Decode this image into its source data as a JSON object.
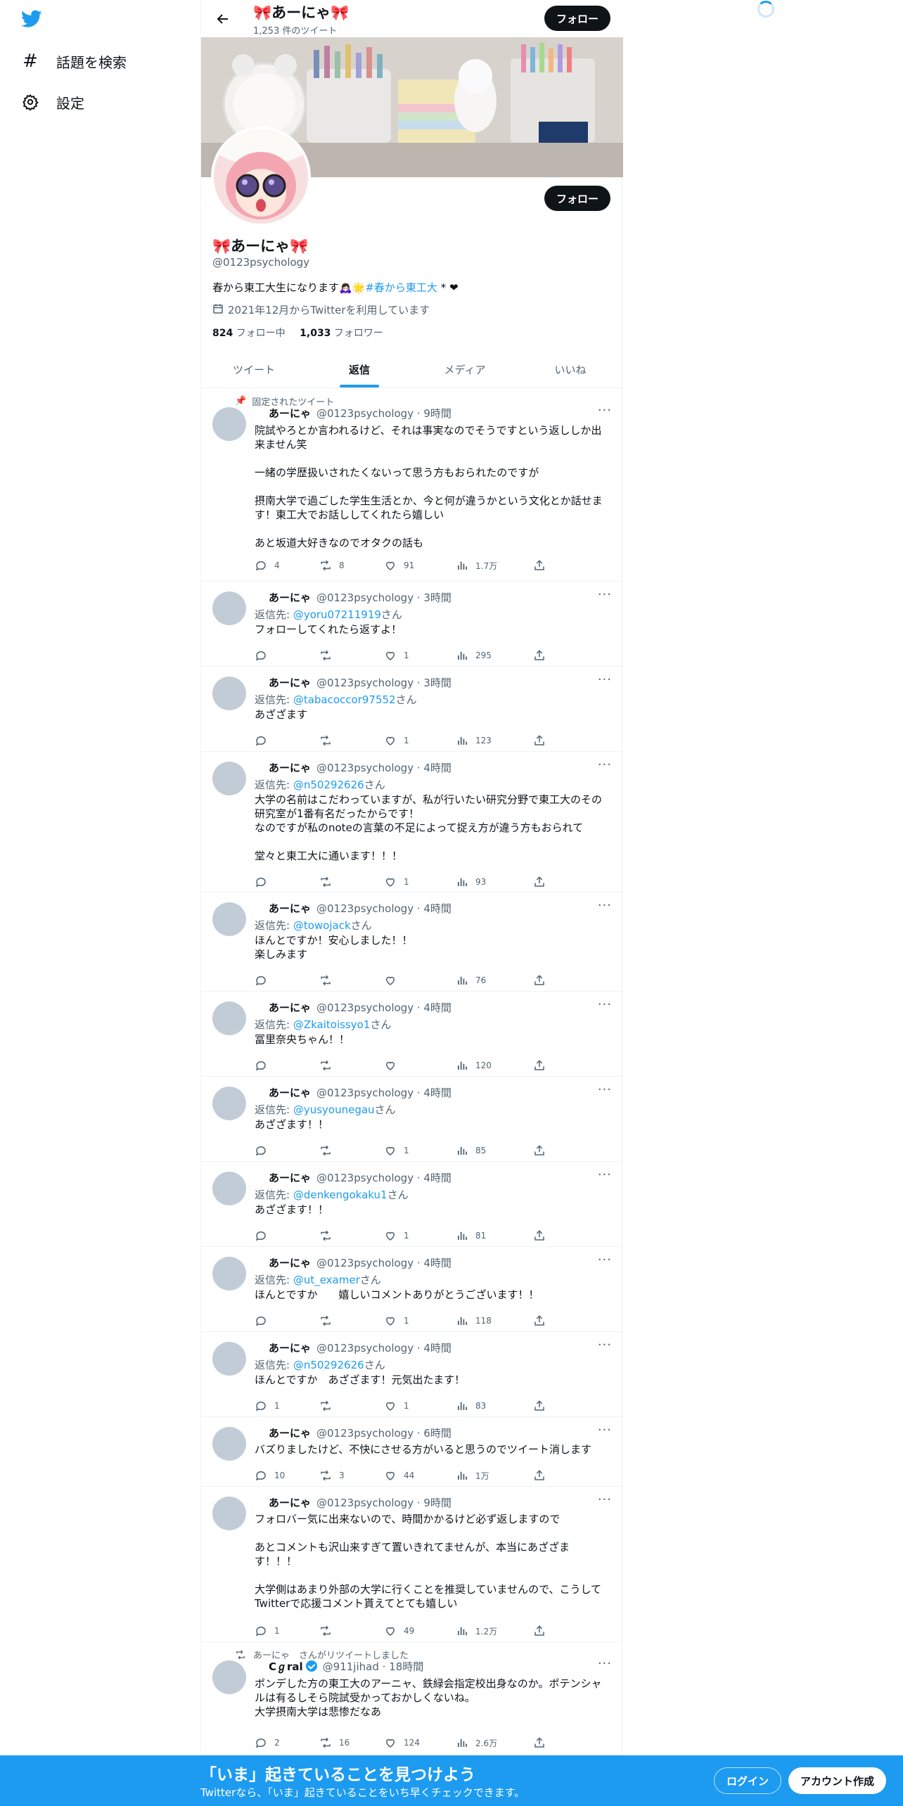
{
  "nav": {
    "items": [
      {
        "label": "話題を検索",
        "icon": "hash-icon"
      },
      {
        "label": "設定",
        "icon": "gear-icon"
      }
    ]
  },
  "header": {
    "name": "🎀あーにゃ🎀",
    "tweet_count": "1,253 件のツイート",
    "follow_label": "フォロー"
  },
  "profile": {
    "name": "🎀あーにゃ🎀",
    "handle": "@0123psychology",
    "bio_before": "春から東工大生になります🙇🏻‍♀️🌟",
    "bio_hashtag": "#春から東工大",
    "bio_after": " * ❤︎",
    "joined": "2021年12月からTwitterを利用しています",
    "following_count": "824",
    "following_label": "フォロー中",
    "followers_count": "1,033",
    "followers_label": "フォロワー",
    "follow_label": "フォロー"
  },
  "tabs": [
    "ツイート",
    "返信",
    "メディア",
    "いいね"
  ],
  "active_tab": "返信",
  "pinned_label": "固定されたツイート",
  "tweets": [
    {
      "name": "あーにゃ",
      "meta": "@0123psychology · 9時間",
      "reply_prefix": "",
      "reply_to": "",
      "reply_suffix": "",
      "text": "院試やろとか言われるけど、それは事実なのでそうですという返ししか出来ません笑\n\n一緒の学歴扱いされたくないって思う方もおられたのですが\n\n摂南大学で過ごした学生生活とか、今と何が違うかという文化とか話せます！東工大でお話ししてくれたら嬉しい\n\nあと坂道大好きなのでオタクの話も",
      "replies": "4",
      "retweets": "8",
      "likes": "91",
      "views": "1.7万"
    },
    {
      "name": "あーにゃ",
      "meta": "@0123psychology · 3時間",
      "reply_prefix": "返信先: ",
      "reply_to": "@yoru07211919",
      "reply_suffix": "さん",
      "text": "フォローしてくれたら返すよ！",
      "replies": "",
      "retweets": "",
      "likes": "1",
      "views": "295"
    },
    {
      "name": "あーにゃ",
      "meta": "@0123psychology · 3時間",
      "reply_prefix": "返信先: ",
      "reply_to": "@tabacoccor97552",
      "reply_suffix": "さん",
      "text": "あざざます",
      "replies": "",
      "retweets": "",
      "likes": "1",
      "views": "123"
    },
    {
      "name": "あーにゃ",
      "meta": "@0123psychology · 4時間",
      "reply_prefix": "返信先: ",
      "reply_to": "@n50292626",
      "reply_suffix": "さん",
      "text": "大学の名前はこだわっていますが、私が行いたい研究分野で東工大のその研究室が1番有名だったからです！\nなのですが私のnoteの言葉の不足によって捉え方が違う方もおられて\n\n堂々と東工大に通います！！！",
      "replies": "",
      "retweets": "",
      "likes": "1",
      "views": "93"
    },
    {
      "name": "あーにゃ",
      "meta": "@0123psychology · 4時間",
      "reply_prefix": "返信先: ",
      "reply_to": "@towojack",
      "reply_suffix": "さん",
      "text": "ほんとですか！安心しました！！\n楽しみます",
      "replies": "",
      "retweets": "",
      "likes": "",
      "views": "76"
    },
    {
      "name": "あーにゃ",
      "meta": "@0123psychology · 4時間",
      "reply_prefix": "返信先: ",
      "reply_to": "@Zkaitoissyo1",
      "reply_suffix": "さん",
      "text": "冨里奈央ちゃん！！",
      "replies": "",
      "retweets": "",
      "likes": "",
      "views": "120"
    },
    {
      "name": "あーにゃ",
      "meta": "@0123psychology · 4時間",
      "reply_prefix": "返信先: ",
      "reply_to": "@yusyounegau",
      "reply_suffix": "さん",
      "text": "あざざます！！",
      "replies": "",
      "retweets": "",
      "likes": "1",
      "views": "85"
    },
    {
      "name": "あーにゃ",
      "meta": "@0123psychology · 4時間",
      "reply_prefix": "返信先: ",
      "reply_to": "@denkengokaku1",
      "reply_suffix": "さん",
      "text": "あざざます！！",
      "replies": "",
      "retweets": "",
      "likes": "1",
      "views": "81"
    },
    {
      "name": "あーにゃ",
      "meta": "@0123psychology · 4時間",
      "reply_prefix": "返信先: ",
      "reply_to": "@ut_examer",
      "reply_suffix": "さん",
      "text": "ほんとですか　　嬉しいコメントありがとうございます！！",
      "replies": "",
      "retweets": "",
      "likes": "1",
      "views": "118"
    },
    {
      "name": "あーにゃ",
      "meta": "@0123psychology · 4時間",
      "reply_prefix": "返信先: ",
      "reply_to": "@n50292626",
      "reply_suffix": "さん",
      "text": "ほんとですか　あざざます！元気出たます！",
      "replies": "1",
      "retweets": "",
      "likes": "1",
      "views": "83"
    },
    {
      "name": "あーにゃ",
      "meta": "@0123psychology · 6時間",
      "reply_prefix": "",
      "reply_to": "",
      "reply_suffix": "",
      "text": "バズりましたけど、不快にさせる方がいると思うのでツイート消します",
      "replies": "10",
      "retweets": "3",
      "likes": "44",
      "views": "1万"
    },
    {
      "name": "あーにゃ",
      "meta": "@0123psychology · 9時間",
      "reply_prefix": "",
      "reply_to": "",
      "reply_suffix": "",
      "text": "フォロバー気に出来ないので、時間かかるけど必ず返しますので\n\nあとコメントも沢山来すぎて置いきれてませんが、本当にあざざます！！！\n\n大学側はあまり外部の大学に行くことを推奨していませんので、こうしてTwitterで応援コメント貰えてとても嬉しい",
      "replies": "1",
      "retweets": "",
      "likes": "49",
      "views": "1.2万"
    },
    {
      "name": "Cℊral",
      "meta": "@911jihad · 18時間",
      "reply_prefix": "",
      "reply_to": "",
      "reply_suffix": "",
      "text": "ポンデした方の東工大のアーニャ、鉄緑会指定校出身なのか。ポテンシャルは有るしそら院試受かっておかしくないね。\n大学摂南大学は悲惨だなあ",
      "replies": "2",
      "retweets": "16",
      "likes": "124",
      "views": "2.6万"
    }
  ],
  "retweet_note": "あーにゃ　さんがリツイートしました",
  "bottom": {
    "title": "「いま」起きていることを見つけよう",
    "subtitle": "Twitterなら、「いま」起きていることをいち早くチェックできます。",
    "login": "ログイン",
    "signup": "アカウント作成"
  }
}
